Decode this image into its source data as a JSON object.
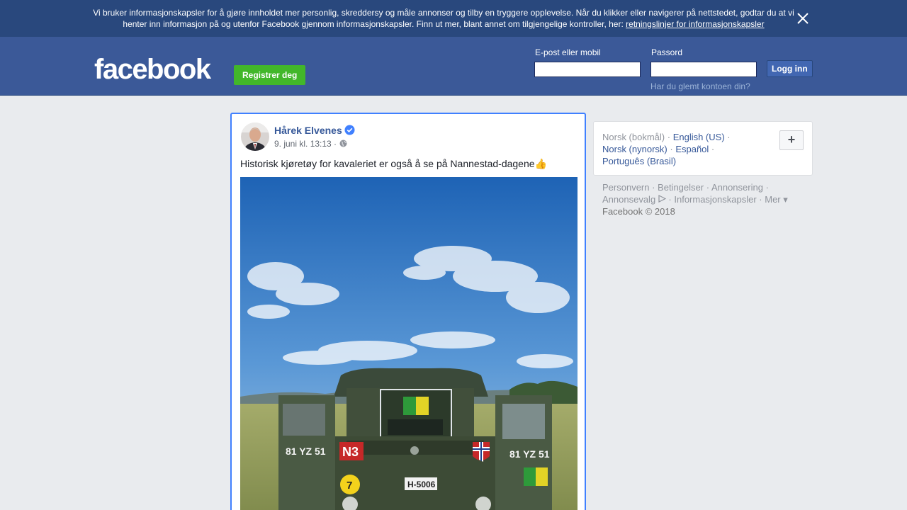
{
  "cookie_banner": {
    "text": "Vi bruker informasjonskapsler for å gjøre innholdet mer personlig, skreddersy og måle annonser og tilby en tryggere opplevelse. Når du klikker eller navigerer på nettstedet, godtar du at vi henter inn informasjon på og utenfor Facebook gjennom informasjonskapsler. Finn ut mer, blant annet om tilgjengelige kontroller, her: ",
    "link": "retningslinjer for informasjonskapsler"
  },
  "header": {
    "logo": "facebook",
    "register_label": "Registrer deg",
    "email_label": "E-post eller mobil",
    "password_label": "Passord",
    "login_label": "Logg inn",
    "forgot_label": "Har du glemt kontoen din?"
  },
  "post": {
    "author": "Hårek Elvenes",
    "date": "9. juni kl. 13:13 ·",
    "text": "Historisk kjøretøy for kavaleriet er også å se på Nannestad-dagene👍",
    "vehicle_plate_left": "81 YZ 51",
    "vehicle_plate_right": "81 YZ 51",
    "vehicle_tag": "N3",
    "vehicle_number": "H-5006",
    "vehicle_badge": "7"
  },
  "languages": {
    "current": "Norsk (bokmål)",
    "items": [
      "English (US)",
      "Norsk (nynorsk)",
      "Español",
      "Português (Brasil)"
    ],
    "more_label": "+"
  },
  "footer": {
    "links": [
      "Personvern",
      "Betingelser",
      "Annonsering",
      "Annonsevalg",
      "Informasjonskapsler",
      "Mer"
    ],
    "copyright": "Facebook © 2018"
  },
  "colors": {
    "brand": "#3b5998",
    "banner": "#29487d",
    "register_green": "#42b72a",
    "link_blue": "#365899",
    "focus_blue": "#4080ff"
  }
}
